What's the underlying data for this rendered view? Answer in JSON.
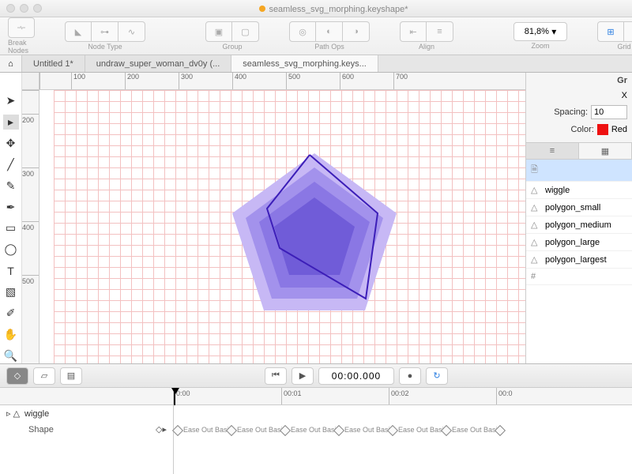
{
  "window": {
    "title": "seamless_svg_morphing.keyshape*"
  },
  "toolbar": {
    "break_nodes": "Break Nodes",
    "node_type": "Node Type",
    "group": "Group",
    "path_ops": "Path Ops",
    "align": "Align",
    "zoom": "Zoom",
    "zoom_value": "81,8%",
    "grid": "Grid"
  },
  "tabs": [
    "Untitled 1*",
    "undraw_super_woman_dv0y (...",
    "seamless_svg_morphing.keys..."
  ],
  "ruler_h": [
    "100",
    "200",
    "300",
    "400",
    "500",
    "600",
    "700"
  ],
  "ruler_v": [
    "200",
    "300",
    "400",
    "500"
  ],
  "right": {
    "title": "Gr",
    "x_label": "X",
    "spacing_label": "Spacing:",
    "spacing_value": "10",
    "color_label": "Color:",
    "color_value": "Red"
  },
  "layers": [
    {
      "icon": "doc",
      "name": "<document>",
      "sel": true
    },
    {
      "icon": "path",
      "name": "wiggle"
    },
    {
      "icon": "path",
      "name": "polygon_small"
    },
    {
      "icon": "path",
      "name": "polygon_medium"
    },
    {
      "icon": "path",
      "name": "polygon_large"
    },
    {
      "icon": "path",
      "name": "polygon_largest"
    },
    {
      "icon": "grid",
      "name": "<grid>"
    }
  ],
  "playback": {
    "time": "00:00.000"
  },
  "timeline": {
    "ticks": [
      "0:00",
      "00:01",
      "00:02",
      "00:0"
    ],
    "layer": "wiggle",
    "prop": "Shape",
    "kf_label": "Ease Out Basic",
    "kf_positions": [
      0,
      68,
      136,
      204,
      272,
      340,
      408
    ]
  },
  "tools": [
    "pointer",
    "direct",
    "rotate",
    "line",
    "pencil",
    "pen",
    "rect",
    "ellipse",
    "text",
    "image",
    "eyedrop",
    "hand",
    "zoom"
  ]
}
